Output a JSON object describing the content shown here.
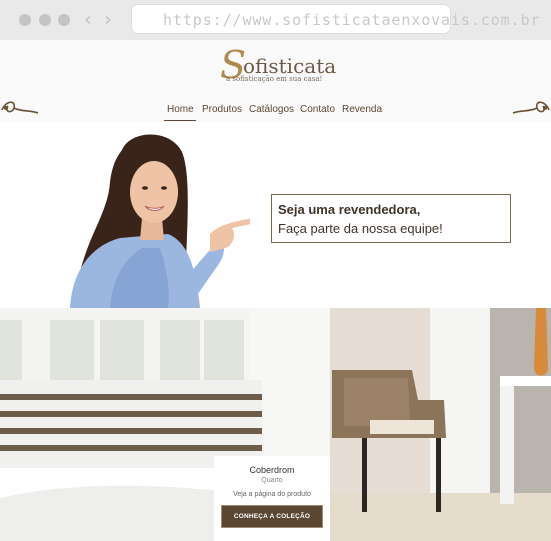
{
  "browser": {
    "url": "https://www.sofisticataenxovais.com.br",
    "controls": [
      "window-close",
      "window-minimize",
      "window-maximize"
    ],
    "nav_icons": [
      "back-arrow-icon",
      "forward-arrow-icon"
    ]
  },
  "logo": {
    "initial": "S",
    "rest": "ofisticata",
    "tagline": "a sofisticação em sua casa!"
  },
  "menu": {
    "items": [
      {
        "label": "Home",
        "active": true
      },
      {
        "label": "Produtos",
        "active": false
      },
      {
        "label": "Catálogos",
        "active": false
      },
      {
        "label": "Contato",
        "active": false
      },
      {
        "label": "Revenda",
        "active": false
      }
    ]
  },
  "hero": {
    "line1": "Seja uma revendedora,",
    "line2": "Faça parte da nossa equipe!"
  },
  "product": {
    "title": "Coberdrom",
    "subtitle": "Quarto",
    "link": "Veja a página do produto",
    "button": "CONHEÇA A COLEÇÃO"
  },
  "colors": {
    "brand_brown": "#5a4633",
    "brand_gold": "#b08a4c",
    "browser_bar": "#e9e9e9"
  }
}
